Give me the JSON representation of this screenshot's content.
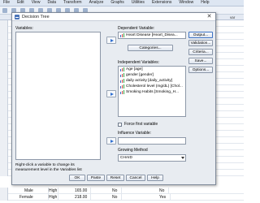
{
  "background": {
    "menu": [
      "File",
      "Edit",
      "View",
      "Data",
      "Transform",
      "Analyze",
      "Graphs",
      "Utilities",
      "Extensions",
      "Window",
      "Help"
    ],
    "column_header_label": "var",
    "rows": [
      {
        "gender": "Male",
        "level": "High",
        "value": "165.00",
        "a": "No",
        "b": "No"
      },
      {
        "gender": "Female",
        "level": "High",
        "value": "218.00",
        "a": "No",
        "b": "Yes"
      }
    ]
  },
  "dialog": {
    "title": "Decision Tree",
    "close_glyph": "✕",
    "variables_label": "Variables:",
    "variables_help": "Right-click a variable to change its measurement level in the Variables list",
    "dependent_label": "Dependent Variable:",
    "dependent_value": "Heart Disease [Heart_Disea...",
    "categories_button": "Categories...",
    "independent_label": "Independent Variables:",
    "independent_items": [
      "Age [age]",
      "gender [gender]",
      "daily activity [daily_activity]",
      "Cholesterol level (mg/dL) [Chol...",
      "Smoking Habits [Smoking_H..."
    ],
    "force_first_label": "Force first variable",
    "influence_label": "Influence Variable:",
    "growing_label": "Growing Method",
    "growing_value": "CHAID",
    "side_buttons": [
      "Output...",
      "Validation...",
      "Criteria...",
      "Save...",
      "Options..."
    ],
    "bottom_buttons": [
      "OK",
      "Paste",
      "Reset",
      "Cancel",
      "Help"
    ]
  }
}
